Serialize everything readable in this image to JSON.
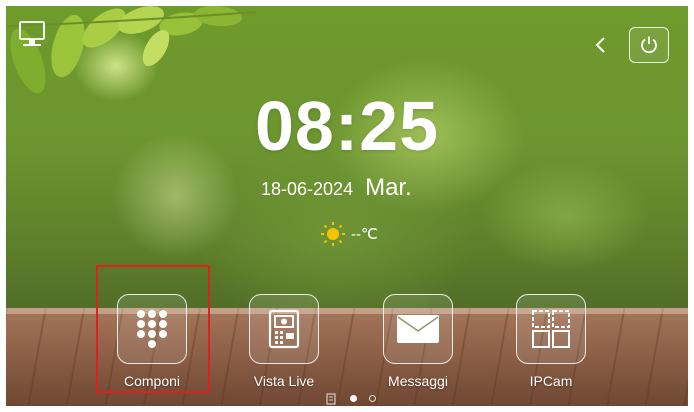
{
  "status": {
    "time": "08:25",
    "date": "18-06-2024",
    "weekday": "Mar.",
    "temperature": "--℃"
  },
  "icons": {
    "monitor": "monitor-icon",
    "back": "chevron-left-icon",
    "power": "power-icon",
    "weather": "sun-icon"
  },
  "apps": [
    {
      "label": "Componi",
      "icon": "keypad-icon",
      "highlighted": true
    },
    {
      "label": "Vista Live",
      "icon": "door-station-icon"
    },
    {
      "label": "Messaggi",
      "icon": "envelope-icon"
    },
    {
      "label": "IPCam",
      "icon": "camera-grid-icon"
    }
  ],
  "pager": {
    "pages": 2,
    "current": 1
  },
  "colors": {
    "highlight": "#e0201c",
    "sun": "#f5c400",
    "text": "#ffffff"
  }
}
